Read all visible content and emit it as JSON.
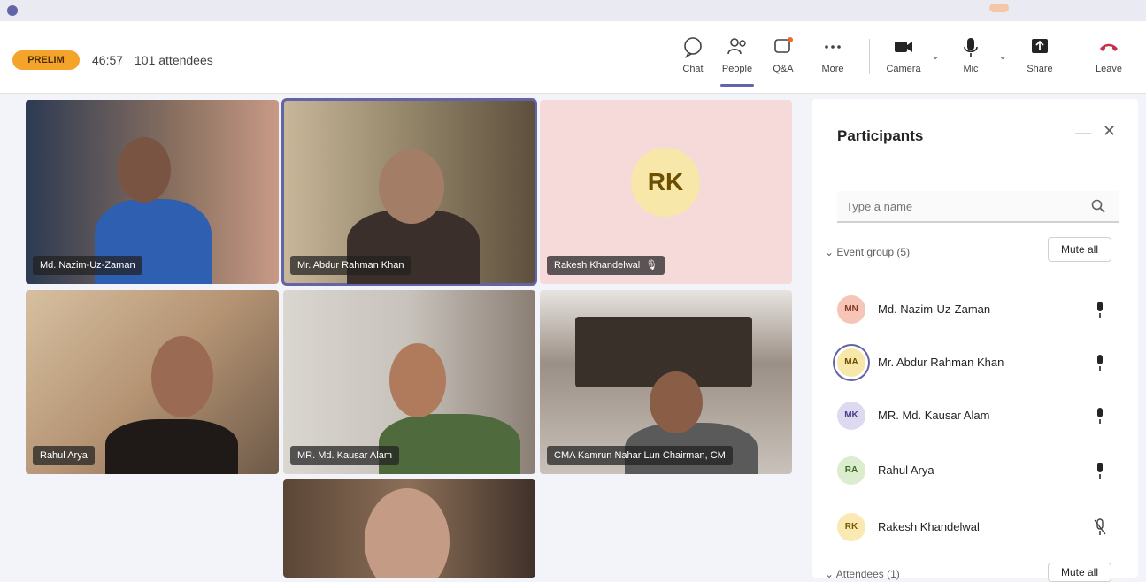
{
  "meeting": {
    "presenter_badge": "PRELIM",
    "timer": "46:57",
    "attendee_count": "101 attendees"
  },
  "toolbar": {
    "chat": "Chat",
    "people": "People",
    "raise": "Q&A",
    "more": "More",
    "camera": "Camera",
    "mic": "Mic",
    "share": "Share",
    "leave": "Leave"
  },
  "tiles": [
    {
      "name": "Md. Nazim-Uz-Zaman"
    },
    {
      "name": "Mr. Abdur Rahman Khan"
    },
    {
      "name": "Rakesh Khandelwal",
      "initials": "RK"
    },
    {
      "name": "Rahul Arya"
    },
    {
      "name": "MR. Md. Kausar Alam"
    },
    {
      "name": "CMA Kamrun Nahar Lun Chairman, CM"
    },
    {
      "name": ""
    }
  ],
  "panel": {
    "title": "Participants",
    "search_placeholder": "Type a name",
    "section_label": "Event group (5)",
    "mute_all": "Mute all",
    "section2_label": "Attendees (1)",
    "mute_all_2": "Mute all",
    "participants": [
      {
        "initials": "MN",
        "name": "Md. Nazim-Uz-Zaman",
        "color": "#f6c5b8",
        "text": "#8a3a22"
      },
      {
        "initials": "MA",
        "name": "Mr. Abdur Rahman Khan",
        "color": "#f7e7a9",
        "text": "#6b4e00"
      },
      {
        "initials": "MK",
        "name": "MR. Md. Kausar Alam",
        "color": "#ddd9f0",
        "text": "#4b3f8a"
      },
      {
        "initials": "RA",
        "name": "Rahul Arya",
        "color": "#dceccf",
        "text": "#3f6a21"
      },
      {
        "initials": "RK",
        "name": "Rakesh Khandelwal",
        "color": "#fbe9b4",
        "text": "#7a5a00"
      }
    ]
  }
}
